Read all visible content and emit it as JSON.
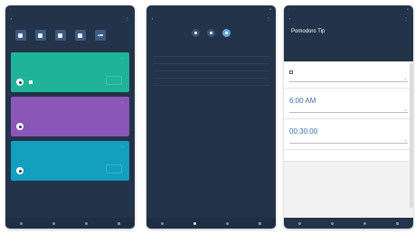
{
  "screens": {
    "p1": {
      "status_time": "",
      "title": "",
      "tools": [
        {
          "label": "",
          "icon": "grid-icon"
        },
        {
          "label": "",
          "icon": "note-icon"
        },
        {
          "label": "",
          "icon": "list-icon"
        },
        {
          "label": "",
          "icon": "doc-icon"
        },
        {
          "label": "",
          "icon": "more-icon"
        }
      ],
      "section": "",
      "cards": [
        {
          "title": "",
          "color": "#1fb39a"
        },
        {
          "title": "",
          "color": "#8a56b8"
        },
        {
          "title": "",
          "color": "#139fbe"
        }
      ]
    },
    "p2": {
      "title": "",
      "tabs": [
        {
          "label": "",
          "active": false
        },
        {
          "label": "",
          "active": false
        },
        {
          "label": "",
          "active": true
        }
      ],
      "rows": [
        {
          "title": "",
          "sub": "",
          "value": ""
        },
        {
          "title": "",
          "sub": "",
          "value": ""
        },
        {
          "title": "",
          "sub": "",
          "value": ""
        },
        {
          "title": "",
          "sub": "",
          "value": ""
        },
        {
          "title": "",
          "sub": "",
          "value": ""
        }
      ],
      "link": ""
    },
    "p3": {
      "title": "Pomodoro Tip",
      "sub": "",
      "action": "",
      "sections": [
        {
          "label": "",
          "checkbox": ""
        },
        {
          "label": "",
          "big": "6:00 AM",
          "link": ""
        },
        {
          "label": "",
          "big": "00:30:00",
          "link": ""
        },
        {
          "label": ""
        }
      ]
    }
  },
  "colors": {
    "dark_bg": "#23334a",
    "accent": "#5fa8e0",
    "green": "#1fb39a",
    "purple": "#8a56b8",
    "teal": "#139fbe"
  }
}
